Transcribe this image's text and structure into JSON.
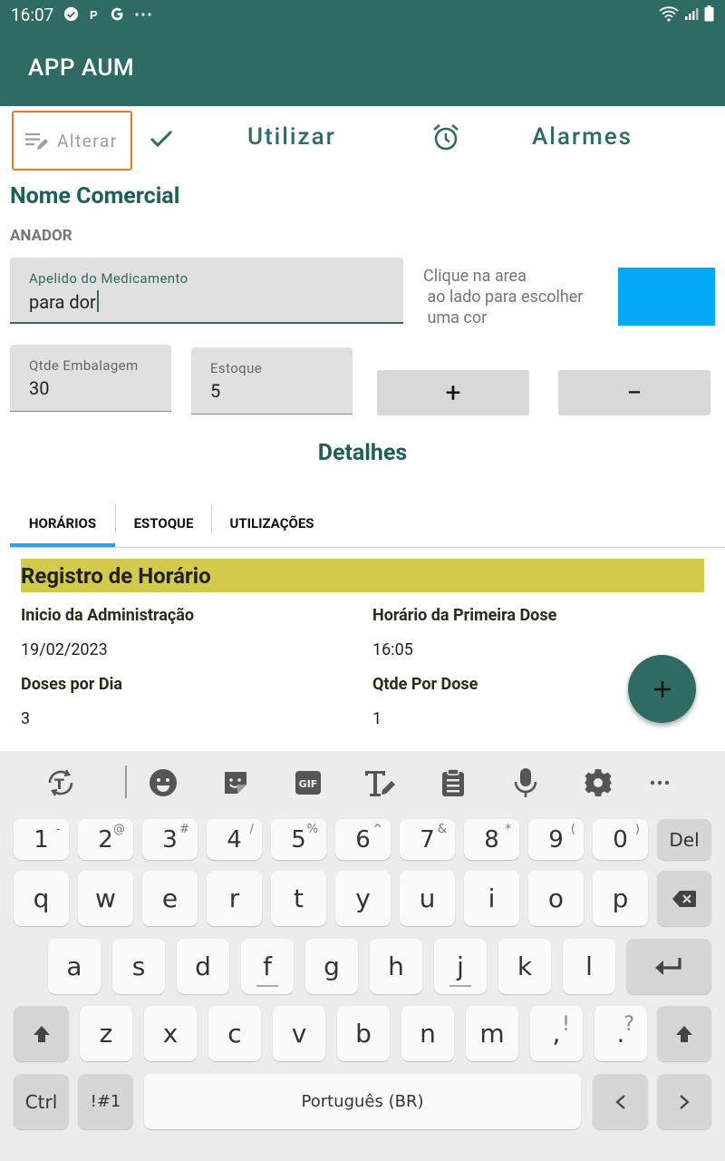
{
  "status_bar": {
    "time": "16:07",
    "icons_left": [
      "check-circle-icon",
      "p-icon",
      "google-icon",
      "more-icon"
    ],
    "icons_right": [
      "wifi-icon",
      "signal-icon",
      "battery-icon"
    ]
  },
  "app_bar": {
    "title": "APP AUM"
  },
  "toolbar": {
    "alterar_label": "Alterar",
    "utilizar_label": "Utilizar",
    "alarmes_label": "Alarmes"
  },
  "med": {
    "nome_label": "Nome Comercial",
    "nome_value": "ANADOR",
    "apelido_label": "Apelido do Medicamento",
    "apelido_value": "para dor",
    "color_hint": "Clique na area\n ao lado para escolher\n uma cor",
    "color": "#03a9f4",
    "qtde_label": "Qtde Embalagem",
    "qtde_value": "30",
    "estoque_label": "Estoque",
    "estoque_value": "5",
    "plus_label": "+",
    "minus_label": "−"
  },
  "detalhes_title": "Detalhes",
  "tabs": [
    {
      "label": "HORÁRIOS",
      "selected": true
    },
    {
      "label": "ESTOQUE",
      "selected": false
    },
    {
      "label": "UTILIZAÇÕES",
      "selected": false
    }
  ],
  "registro": {
    "title": "Registro de Horário",
    "inicio_label": "Inicio da Administração",
    "inicio_value": "19/02/2023",
    "primeira_label": "Horário da Primeira Dose",
    "primeira_value": "16:05",
    "doses_label": "Doses por Dia",
    "doses_value": "3",
    "qtde_dose_label": "Qtde Por Dose",
    "qtde_dose_value": "1"
  },
  "fab_label": "+",
  "keyboard": {
    "toolbar_icons": [
      "translate-icon",
      "emoji-icon",
      "sticker-icon",
      "gif-icon",
      "text-edit-icon",
      "clipboard-icon",
      "mic-icon",
      "settings-icon",
      "more-icon"
    ],
    "num_row": [
      {
        "k": "1",
        "s": "-"
      },
      {
        "k": "2",
        "s": "@"
      },
      {
        "k": "3",
        "s": "#"
      },
      {
        "k": "4",
        "s": "/"
      },
      {
        "k": "5",
        "s": "%"
      },
      {
        "k": "6",
        "s": "^"
      },
      {
        "k": "7",
        "s": "&"
      },
      {
        "k": "8",
        "s": "*"
      },
      {
        "k": "9",
        "s": "("
      },
      {
        "k": "0",
        "s": ")"
      }
    ],
    "del_label": "Del",
    "row1": [
      "q",
      "w",
      "e",
      "r",
      "t",
      "y",
      "u",
      "i",
      "o",
      "p"
    ],
    "row2": [
      "a",
      "s",
      "d",
      "f",
      "g",
      "h",
      "j",
      "k",
      "l"
    ],
    "row3": [
      "z",
      "x",
      "c",
      "v",
      "b",
      "n",
      "m"
    ],
    "comma": ",",
    "comma_sub": "!",
    "period": ".",
    "period_sub": "?",
    "ctrl_label": "Ctrl",
    "sym_label": "!#1",
    "space_label": "Português (BR)"
  }
}
